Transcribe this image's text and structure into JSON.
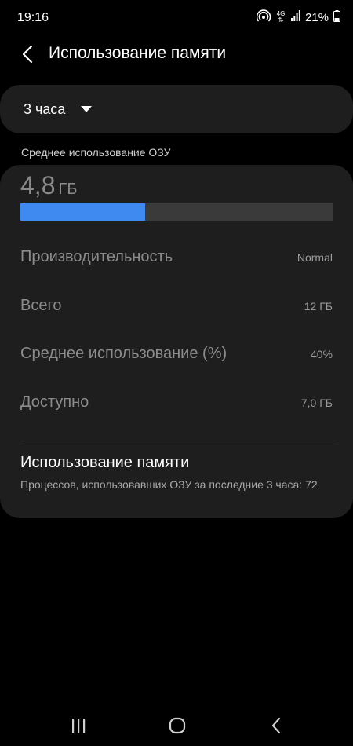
{
  "status_bar": {
    "time": "19:16",
    "network_type": "4G",
    "battery_percent": "21%"
  },
  "header": {
    "title": "Использование памяти"
  },
  "period": {
    "selected": "3 часа"
  },
  "ram": {
    "section_label": "Среднее использование ОЗУ",
    "value": "4,8",
    "unit": "ГБ",
    "usage_fraction": 0.4,
    "bar_fill_color": "#3e8af0",
    "bar_track_color": "#3a3a3a"
  },
  "stats": [
    {
      "label": "Производительность",
      "value": "Normal"
    },
    {
      "label": "Всего",
      "value": "12 ГБ"
    },
    {
      "label": "Среднее использование (%)",
      "value": "40%"
    },
    {
      "label": "Доступно",
      "value": "7,0 ГБ"
    }
  ],
  "memory_usage": {
    "title": "Использование памяти",
    "description": "Процессов, использовавших ОЗУ за последние 3 часа: 72"
  },
  "icons": {
    "back": "chevron-left-icon",
    "dropdown": "caret-down-icon",
    "nav_recent": "recent-apps-icon",
    "nav_home": "home-icon",
    "nav_back": "back-icon"
  },
  "colors": {
    "background": "#000000",
    "card": "#1e1e1e",
    "accent": "#3e8af0"
  }
}
